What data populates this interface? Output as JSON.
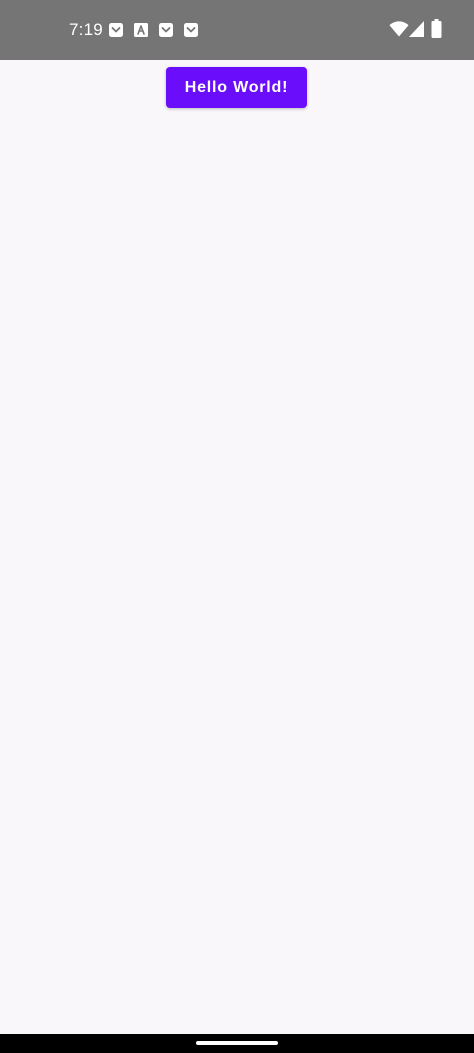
{
  "status_bar": {
    "time": "7:19",
    "background": "#757575",
    "notifications": [
      "pocket-icon",
      "a-box-icon",
      "pocket-icon",
      "pocket-icon"
    ],
    "system_icons": [
      "wifi-icon",
      "signal-icon",
      "battery-icon"
    ]
  },
  "main": {
    "background": "#FAF7FB",
    "button": {
      "label": "Hello World!",
      "color": "#6A0DFB",
      "text_color": "#FFFFFF"
    }
  },
  "nav_bar": {
    "background": "#000000",
    "handle": "home-handle"
  }
}
